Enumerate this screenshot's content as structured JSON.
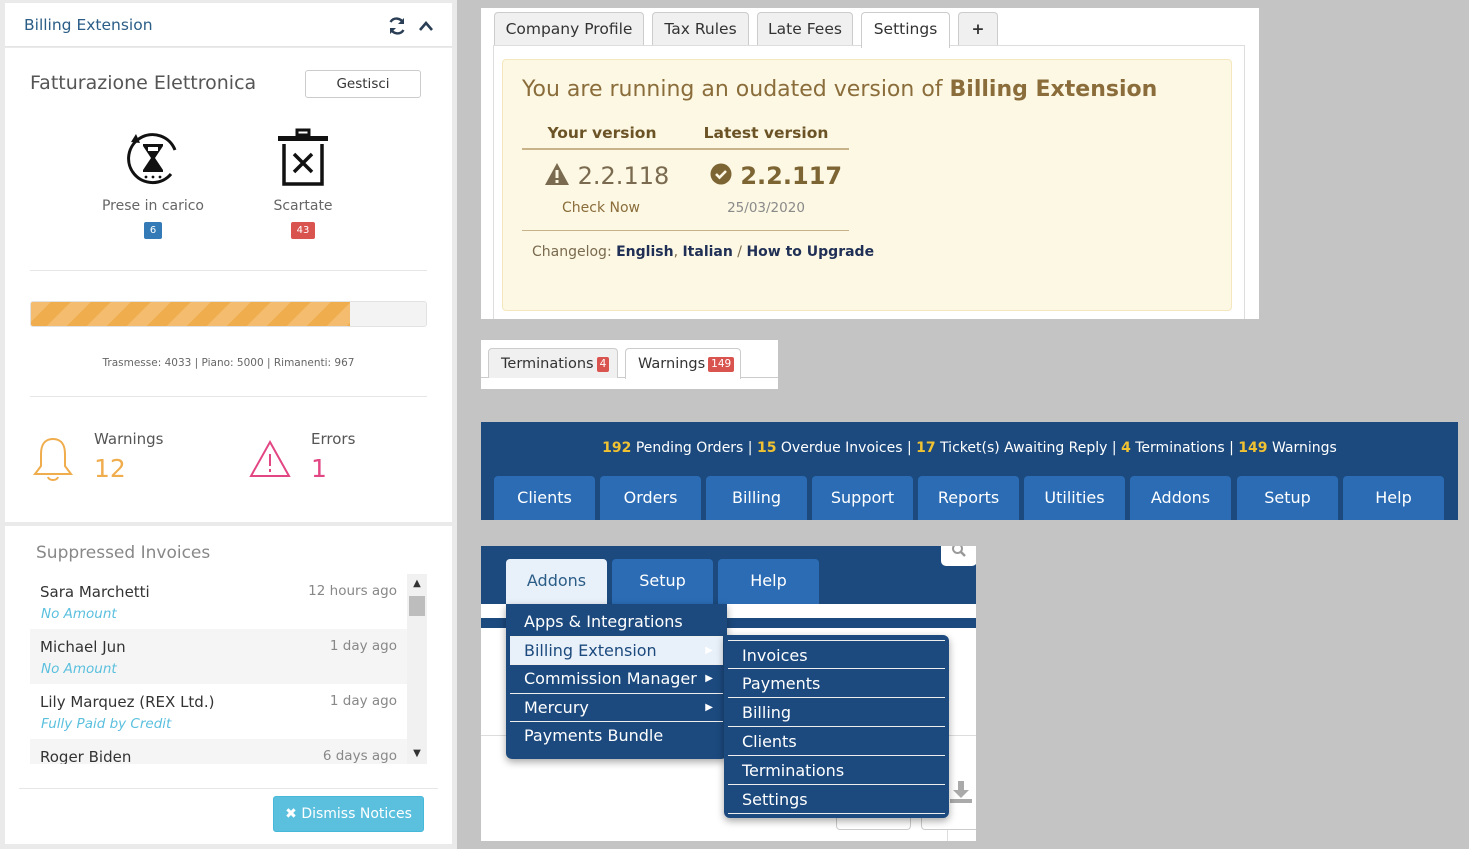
{
  "widget": {
    "title": "Billing Extension",
    "section_title": "Fatturazione Elettronica",
    "manage_button": "Gestisci",
    "stats": [
      {
        "label": "Prese in carico",
        "count": "6",
        "color": "#337ab7"
      },
      {
        "label": "Scartate",
        "count": "43",
        "color": "#d9534f"
      }
    ],
    "progress": {
      "percent": 80.7,
      "usage_text": "Trasmesse: 4033 | Piano: 5000 | Rimanenti: 967"
    },
    "alerts": [
      {
        "label": "Warnings",
        "value": "12",
        "color": "#f0ad4e"
      },
      {
        "label": "Errors",
        "value": "1",
        "color": "#e24683"
      }
    ],
    "suppressed": {
      "title": "Suppressed Invoices",
      "rows": [
        {
          "name": "Sara Marchetti",
          "time": "12 hours ago",
          "status": "No Amount"
        },
        {
          "name": "Michael Jun",
          "time": "1 day ago",
          "status": "No Amount"
        },
        {
          "name": "Lily Marquez (REX Ltd.)",
          "time": "1 day ago",
          "status": "Fully Paid by Credit"
        },
        {
          "name": "Roger Biden",
          "time": "6 days ago",
          "status": ""
        }
      ]
    },
    "dismiss_button": "Dismiss Notices"
  },
  "version_panel": {
    "tabs": [
      "Company Profile",
      "Tax Rules",
      "Late Fees",
      "Settings",
      "+"
    ],
    "active_tab": "Settings",
    "message_prefix": "You are running an oudated version of ",
    "message_product": "Billing Extension",
    "your_version_label": "Your version",
    "latest_version_label": "Latest version",
    "your_version": "2.2.118",
    "latest_version": "2.2.117",
    "check_now": "Check Now",
    "release_date": "25/03/2020",
    "changelog_label": "Changelog: ",
    "changelog_english": "English",
    "changelog_sep1": ", ",
    "changelog_italian": "Italian",
    "changelog_sep2": " / ",
    "changelog_upgrade": "How to Upgrade"
  },
  "term_tabs": [
    {
      "label": "Terminations",
      "count": "4"
    },
    {
      "label": "Warnings",
      "count": "149"
    }
  ],
  "navbar": {
    "notice": [
      {
        "num": "192",
        "text": " Pending Orders | "
      },
      {
        "num": "15",
        "text": " Overdue Invoices | "
      },
      {
        "num": "17",
        "text": " Ticket(s) Awaiting Reply | "
      },
      {
        "num": "4",
        "text": " Terminations | "
      },
      {
        "num": "149",
        "text": " Warnings"
      }
    ],
    "items": [
      "Clients",
      "Orders",
      "Billing",
      "Support",
      "Reports",
      "Utilities",
      "Addons",
      "Setup",
      "Help"
    ]
  },
  "dropdown": {
    "top_items": [
      "Addons",
      "Setup",
      "Help"
    ],
    "menu": [
      "Apps & Integrations",
      "Billing Extension",
      "Commission Manager",
      "Mercury",
      "Payments Bundle"
    ],
    "submenu": [
      "Invoices",
      "Payments",
      "Billing",
      "Clients",
      "Terminations",
      "Settings"
    ]
  }
}
